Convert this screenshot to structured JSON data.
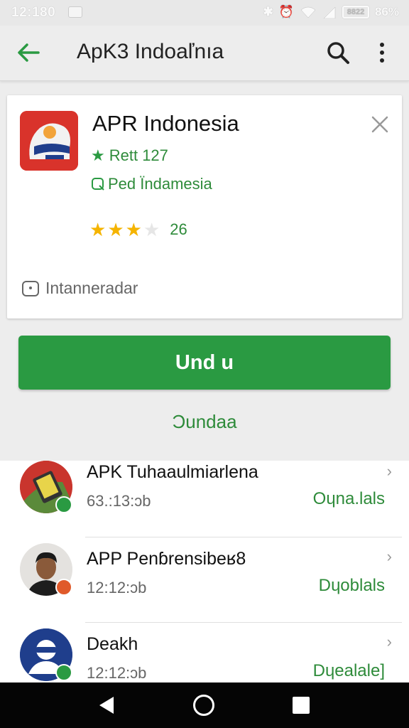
{
  "status_bar": {
    "time": "12:180",
    "battery_text": "8822",
    "battery_percent": "86%"
  },
  "app_bar": {
    "title": "ApK3 Indoaľnıa",
    "back_icon": "arrow-left",
    "search_icon": "search",
    "more_icon": "more-vert",
    "accent": "#2a9a42"
  },
  "app_card": {
    "name": "APR Indonesia",
    "rating_label": "Rett 127",
    "publisher": "Ped Ϊndamesia",
    "star_rating": 3,
    "star_max": 5,
    "rating_count": "26",
    "footer_label": "Intanneradar",
    "close_icon": "close"
  },
  "actions": {
    "install_label": "Und u",
    "secondary_label": "Ɔundaa"
  },
  "list": [
    {
      "title": "APK Tuhaaulmiarlena",
      "subtitle": "63.:13:ɔb",
      "action": "Oɥna.lals",
      "avatar": "android-tablet-icon",
      "badge_color": "#2a9a42"
    },
    {
      "title": "APP Penɓrensibeʁ8",
      "subtitle": "12:12:ɔb",
      "action": "Dɥoblals",
      "avatar": "person-photo",
      "badge_color": "#e05a2a"
    },
    {
      "title": "Deakh",
      "subtitle": "12:12:ɔb",
      "action": "Dɥealale]",
      "avatar": "user-silhouette-icon",
      "badge_color": "#2a9a42"
    }
  ],
  "colors": {
    "green": "#2a9a42",
    "star": "#f5b400",
    "app_icon_red": "#d9332b"
  }
}
